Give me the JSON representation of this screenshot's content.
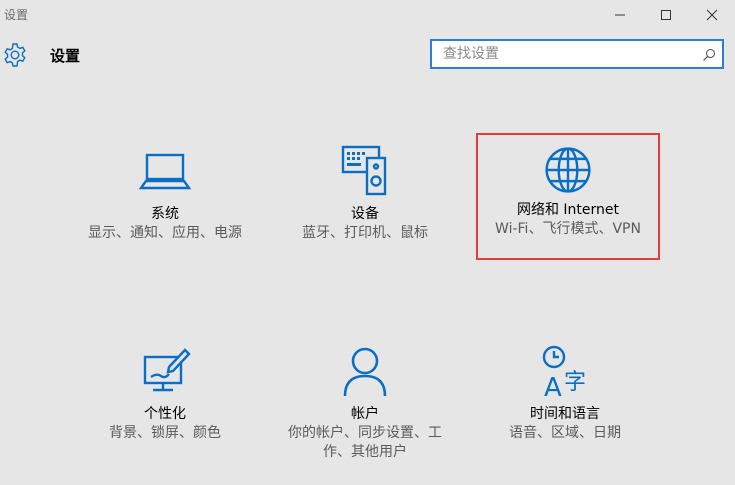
{
  "window": {
    "title": "设置",
    "controls": [
      "minimize-icon",
      "maximize-icon",
      "close-icon"
    ]
  },
  "header": {
    "icon": "gear-icon",
    "title": "设置"
  },
  "search": {
    "placeholder": "查找设置",
    "value": "",
    "icon": "search-icon",
    "border_color": "#2b7fd4"
  },
  "tiles": [
    {
      "icon": "laptop-icon",
      "title": "系统",
      "desc": "显示、通知、应用、电源"
    },
    {
      "icon": "devices-icon",
      "title": "设备",
      "desc": "蓝牙、打印机、鼠标"
    },
    {
      "icon": "globe-icon",
      "title": "网络和 Internet",
      "desc": "Wi-Fi、飞行模式、VPN",
      "highlighted": true
    },
    {
      "icon": "personalization-icon",
      "title": "个性化",
      "desc": "背景、锁屏、颜色"
    },
    {
      "icon": "person-icon",
      "title": "帐户",
      "desc": "你的帐户、同步设置、工作、其他用户"
    },
    {
      "icon": "time-language-icon",
      "title": "时间和语言",
      "desc": "语音、区域、日期"
    }
  ],
  "colors": {
    "accent": "#0a6fc2",
    "highlight_border": "#e43b3b",
    "background": "#e6e6e6"
  }
}
